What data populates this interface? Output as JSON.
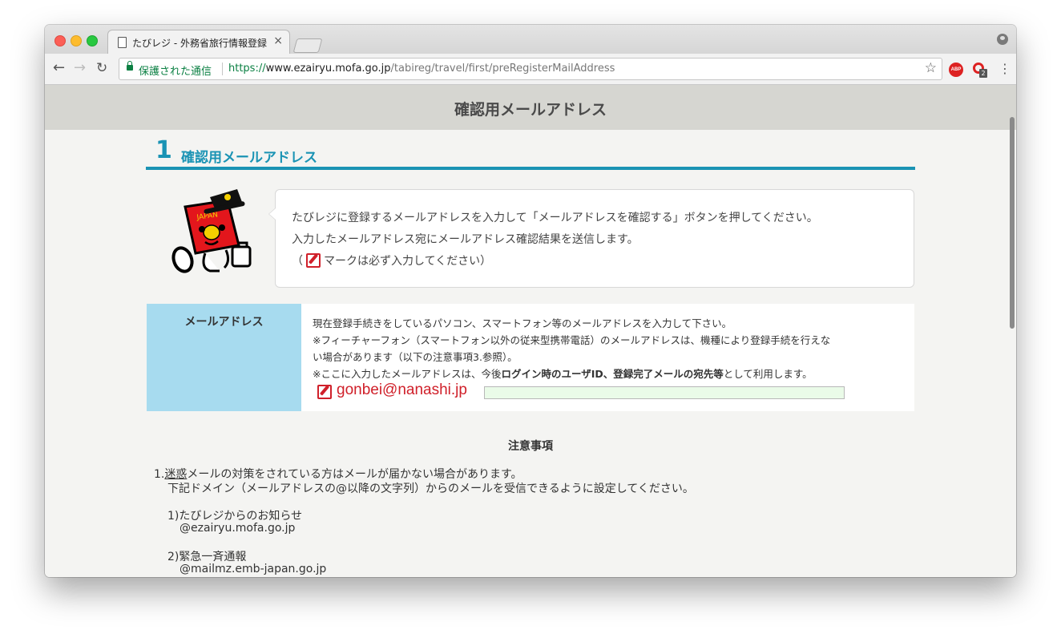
{
  "browser": {
    "tab_title": "たびレジ - 外務省旅行情報登録",
    "tab_close": "×",
    "security_label": "保護された通信",
    "url_scheme": "https://",
    "url_host": "www.ezairyu.mofa.go.jp",
    "url_path": "/tabireg/travel/first/preRegisterMailAddress",
    "ext_abp_label": "ABP",
    "ext_badge": "2",
    "nav_back": "←",
    "nav_forward": "→",
    "nav_reload": "↻",
    "star": "☆",
    "menu": "⋮"
  },
  "page": {
    "header_title": "確認用メールアドレス",
    "section_number": "1",
    "section_title": "確認用メールアドレス",
    "info": {
      "line1": "たびレジに登録するメールアドレスを入力して「メールアドレスを確認する」ボタンを押してください。",
      "line2": "入力したメールアドレス宛にメールアドレス確認結果を送信します。",
      "line3_open": "（",
      "line3_rest": "マークは必ず入力してください）"
    },
    "form": {
      "label": "メールアドレス",
      "desc1": "現在登録手続きをしているパソコン、スマートフォン等のメールアドレスを入力して下さい。",
      "desc2": "※フィーチャーフォン（スマートフォン以外の従来型携帯電話）のメールアドレスは、機種により登録手続を行えな",
      "desc3": "い場合があります（以下の注意事項3.参照）。",
      "desc4_pre": "※ここに入力したメールアドレスは、今後",
      "desc4_bold": "ログイン時のユーザID、登録完了メールの宛先等",
      "desc4_post": "として利用します。",
      "email_value": "gonbei@nanashi.jp"
    },
    "notes": {
      "title": "注意事項",
      "item1_num": "1.",
      "item1_underlined": "迷惑",
      "item1_rest": "メールの対策をされている方はメールが届かない場合があります。",
      "item1_line2": "下記ドメイン（メールアドレスの@以降の文字列）からのメールを受信できるように設定してください。",
      "sub1_label": "1)たびレジからのお知らせ",
      "sub1_domain": "@ezairyu.mofa.go.jp",
      "sub2_label": "2)緊急一斉通報",
      "sub2_domain": "@mailmz.emb-japan.go.jp"
    },
    "mascot_text": "JAPAN"
  },
  "colors": {
    "accent": "#1a93b4",
    "label_bg": "#a7dbef",
    "required_red": "#d0202a",
    "secure_green": "#0b8043"
  }
}
